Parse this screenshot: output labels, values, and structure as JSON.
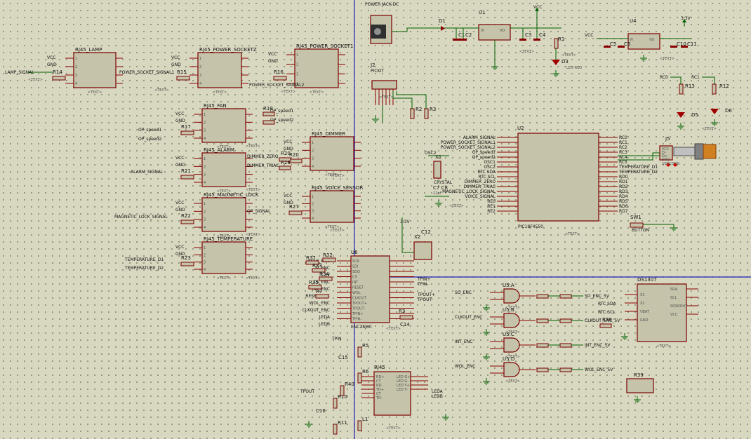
{
  "rj45_modules": [
    {
      "ref": "RJ45_LAMP",
      "net": "LAMP_SIGNAL",
      "res": "R14"
    },
    {
      "ref": "RJ45_POWER_SOCKETZ",
      "net": "POWER_SOCKET_SIGNAL1",
      "res": "R15"
    },
    {
      "ref": "RJ45_POWER_SOCKET1",
      "net": "POWER_SOCKET_SIGNAL2",
      "res": "R16"
    },
    {
      "ref": "RJ45_FAN",
      "net": "OP_speed1",
      "res": "R17"
    },
    {
      "ref": "RJ45_ALARM",
      "net": "ALARM_SIGNAL",
      "res": "R21"
    },
    {
      "ref": "RJ45_MAGNETIC_LOCK",
      "net": "MAGNETIC_LOCK_SIGNAL",
      "res": "R22"
    },
    {
      "ref": "RJ45_TEMPERATURE",
      "net": "TEMPERATURE_D",
      "res": "R23"
    },
    {
      "ref": "RJ45_DIMMER",
      "net": "DIMMER_ZERO",
      "res": "R20"
    },
    {
      "ref": "RJ45_VOICE_SENSOR",
      "net": "OP_SIGNAL",
      "res": "R27"
    }
  ],
  "power": {
    "jack": "POWER JACK-DC",
    "u1": "U1",
    "u4": "U4",
    "vcc": "VCC",
    "gnd": "GND",
    "v33": "3.3V"
  },
  "mcu": {
    "ref": "U2",
    "chip": "PIC18F4550",
    "pins_left": [
      "ALARM_SIGNAL",
      "POWER_SOCKET_SIGNAL1",
      "POWER_SOCKET_SIGNAL2",
      "OP_speed1",
      "OP_speed2",
      "OSC1",
      "OSC2",
      "RTC SDA",
      "RTC SCL",
      "DIMMER_ZERO",
      "DIMMER_TRIAC",
      "MAGNETIC_LOCK_SIGNAL",
      "VOICE_SIGNAL",
      "RE0",
      "RE1",
      "RE2"
    ],
    "pins_right": [
      "RC0",
      "RC1",
      "RC2",
      "RC3",
      "RC4",
      "RC5",
      "TEMPERATURE_D1",
      "TEMPERATURE_D2",
      "RD0",
      "RD1",
      "RD2",
      "RD3",
      "RD4",
      "RD5",
      "RD6",
      "RD7"
    ]
  },
  "crystal": {
    "ref": "X1",
    "label": "CRYSTAL",
    "caps": "C7 C8",
    "value": "22pF"
  },
  "usb": {
    "ref": "J5",
    "pins": [
      "VCC",
      "D-",
      "D+",
      "GND"
    ],
    "label": "USBCONN"
  },
  "enc": {
    "ref": "U6",
    "chip": "ENC28J60",
    "pins": [
      "SCK",
      "SDI",
      "SDO",
      "CS",
      "INT",
      "RESET",
      "WOL",
      "CLKOUT",
      "TPOUT+",
      "TPOUT-",
      "TPIN+",
      "TPIN-"
    ]
  },
  "rj45_eth": {
    "ref": "RJ45",
    "pins": [
      "RD+",
      "CT",
      "RD-",
      "TD+",
      "CT",
      "TD-",
      "LED G+",
      "LED G-",
      "LED Y+",
      "LED Y-"
    ]
  },
  "gates": [
    {
      "ref": "U5:A",
      "in": "SO_ENC",
      "out": "SO_ENC_5V"
    },
    {
      "ref": "U5:B",
      "in": "CLKOUT_ENC",
      "out": "CLKOUT_ENC_5V"
    },
    {
      "ref": "U5:C",
      "in": "INT_ENC",
      "out": "INT_ENC_5V"
    },
    {
      "ref": "U5:D",
      "in": "WOL_ENC",
      "out": "WOL_ENC_5V"
    }
  ],
  "rtc": {
    "ref": "DS1307",
    "pins_left": [
      "X1",
      "X2",
      "VBAT",
      "GND"
    ],
    "pins_right": [
      "SDA",
      "SCL",
      "SQW/OUT",
      "VCC"
    ]
  },
  "misc": {
    "button": "BUTTON",
    "icsp": "J2",
    "icsp_label": "PICKIT",
    "leds": [
      "D3",
      "D5",
      "D6"
    ],
    "crystal2": "X2"
  }
}
